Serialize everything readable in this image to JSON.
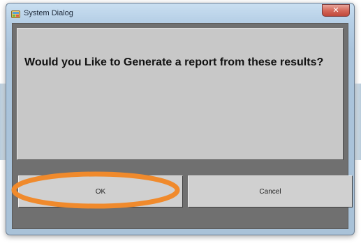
{
  "window": {
    "title": "System Dialog",
    "close_glyph": "✕",
    "icon": "app-icon"
  },
  "dialog": {
    "message": "Would you Like to Generate a report from these results?"
  },
  "buttons": {
    "ok_label": "OK",
    "cancel_label": "Cancel"
  },
  "annotation": {
    "highlight_color": "#f08a2c"
  }
}
